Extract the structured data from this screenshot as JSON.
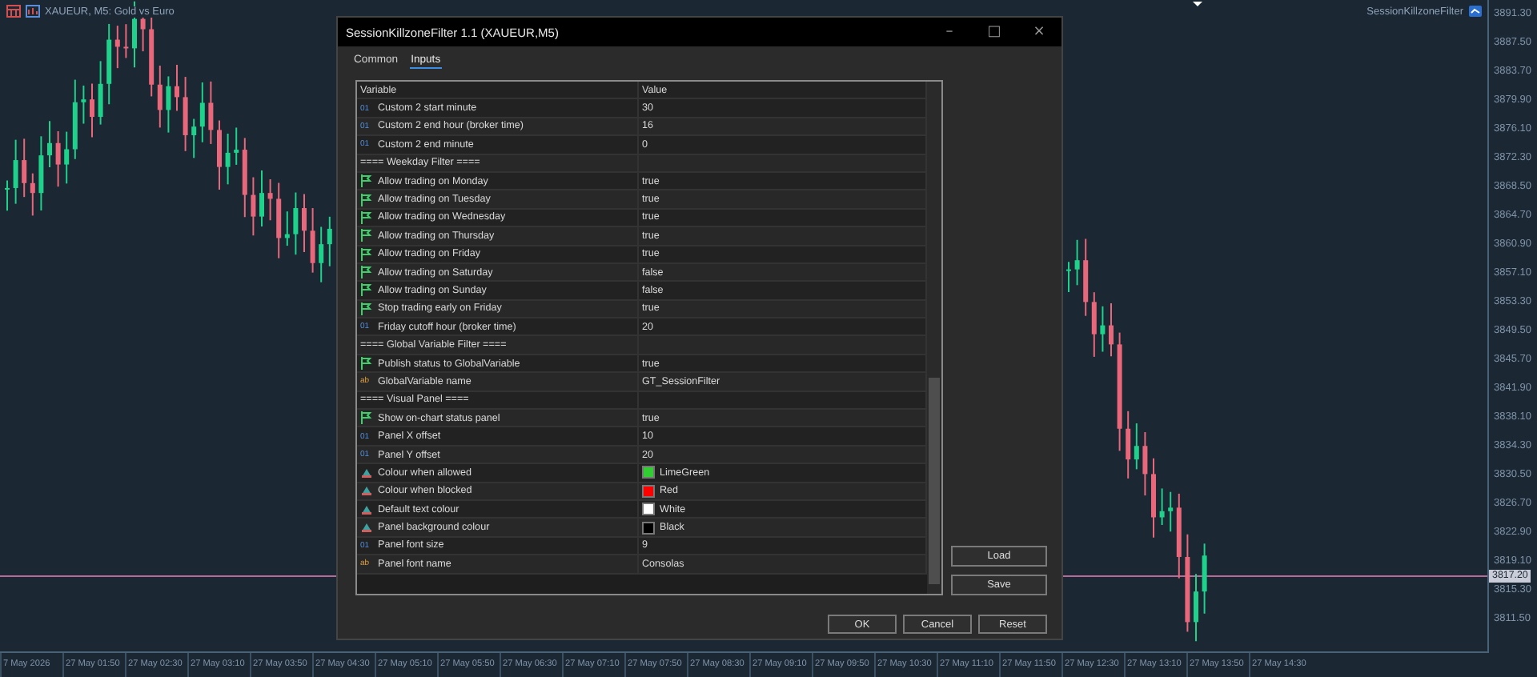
{
  "chart": {
    "symbol_label": "XAUEUR, M5:  Gold vs Euro",
    "indicator_label": "SessionKillzoneFilter",
    "price_labels": [
      "3891.30",
      "3887.50",
      "3883.70",
      "3879.90",
      "3876.10",
      "3872.30",
      "3868.50",
      "3864.70",
      "3860.90",
      "3857.10",
      "3853.30",
      "3849.50",
      "3845.70",
      "3841.90",
      "3838.10",
      "3834.30",
      "3830.50",
      "3826.70",
      "3822.90",
      "3819.10",
      "3815.30",
      "3811.50"
    ],
    "current_price": "3817.20",
    "time_labels": [
      "7 May 2026",
      "27 May 01:50",
      "27 May 02:30",
      "27 May 03:10",
      "27 May 03:50",
      "27 May 04:30",
      "27 May 05:10",
      "27 May 05:50",
      "27 May 06:30",
      "27 May 07:10",
      "27 May 07:50",
      "27 May 08:30",
      "27 May 09:10",
      "27 May 09:50",
      "27 May 10:30",
      "27 May 11:10",
      "27 May 11:50",
      "27 May 12:30",
      "27 May 13:10",
      "27 May 13:50",
      "27 May 14:30"
    ]
  },
  "dialog": {
    "title": "SessionKillzoneFilter 1.1 (XAUEUR,M5)",
    "window_buttons": [
      "–",
      "□",
      "×"
    ],
    "tabs": [
      {
        "label": "Common",
        "selected": false
      },
      {
        "label": "Inputs",
        "selected": true
      }
    ],
    "table": {
      "columns": [
        "Variable",
        "Value"
      ],
      "rows": [
        {
          "kind": "int",
          "badge": "01",
          "variable": "Custom 2 start minute",
          "value": "30"
        },
        {
          "kind": "int",
          "badge": "01",
          "variable": "Custom 2 end hour (broker time)",
          "value": "16"
        },
        {
          "kind": "int",
          "badge": "01",
          "variable": "Custom 2 end minute",
          "value": "0"
        },
        {
          "kind": "header",
          "variable": "==== Weekday Filter ===="
        },
        {
          "kind": "bool",
          "variable": "Allow trading on Monday",
          "value": "true"
        },
        {
          "kind": "bool",
          "variable": "Allow trading on Tuesday",
          "value": "true"
        },
        {
          "kind": "bool",
          "variable": "Allow trading on Wednesday",
          "value": "true"
        },
        {
          "kind": "bool",
          "variable": "Allow trading on Thursday",
          "value": "true"
        },
        {
          "kind": "bool",
          "variable": "Allow trading on Friday",
          "value": "true"
        },
        {
          "kind": "bool",
          "variable": "Allow trading on Saturday",
          "value": "false"
        },
        {
          "kind": "bool",
          "variable": "Allow trading on Sunday",
          "value": "false"
        },
        {
          "kind": "bool",
          "variable": "Stop trading early on Friday",
          "value": "true"
        },
        {
          "kind": "int",
          "badge": "01",
          "variable": "Friday cutoff hour (broker time)",
          "value": "20"
        },
        {
          "kind": "header",
          "variable": "==== Global Variable Filter ===="
        },
        {
          "kind": "bool",
          "variable": "Publish status to GlobalVariable",
          "value": "true"
        },
        {
          "kind": "string",
          "badge": "ab",
          "variable": "GlobalVariable name",
          "value": "GT_SessionFilter"
        },
        {
          "kind": "header",
          "variable": "==== Visual Panel ===="
        },
        {
          "kind": "bool",
          "variable": "Show on-chart status panel",
          "value": "true"
        },
        {
          "kind": "int",
          "badge": "01",
          "variable": "Panel X offset",
          "value": "10"
        },
        {
          "kind": "int",
          "badge": "01",
          "variable": "Panel Y offset",
          "value": "20"
        },
        {
          "kind": "color",
          "variable": "Colour when allowed",
          "value": "LimeGreen",
          "color": "#32cd32"
        },
        {
          "kind": "color",
          "variable": "Colour when blocked",
          "value": "Red",
          "color": "#ff0000"
        },
        {
          "kind": "color",
          "variable": "Default text colour",
          "value": "White",
          "color": "#ffffff"
        },
        {
          "kind": "color",
          "variable": "Panel background colour",
          "value": "Black",
          "color": "#000000"
        },
        {
          "kind": "int",
          "badge": "01",
          "variable": "Panel font size",
          "value": "9"
        },
        {
          "kind": "string",
          "badge": "ab",
          "variable": "Panel font name",
          "value": "Consolas"
        }
      ]
    },
    "side_buttons": [
      "Load",
      "Save"
    ],
    "buttons": [
      "OK",
      "Cancel",
      "Reset"
    ]
  }
}
